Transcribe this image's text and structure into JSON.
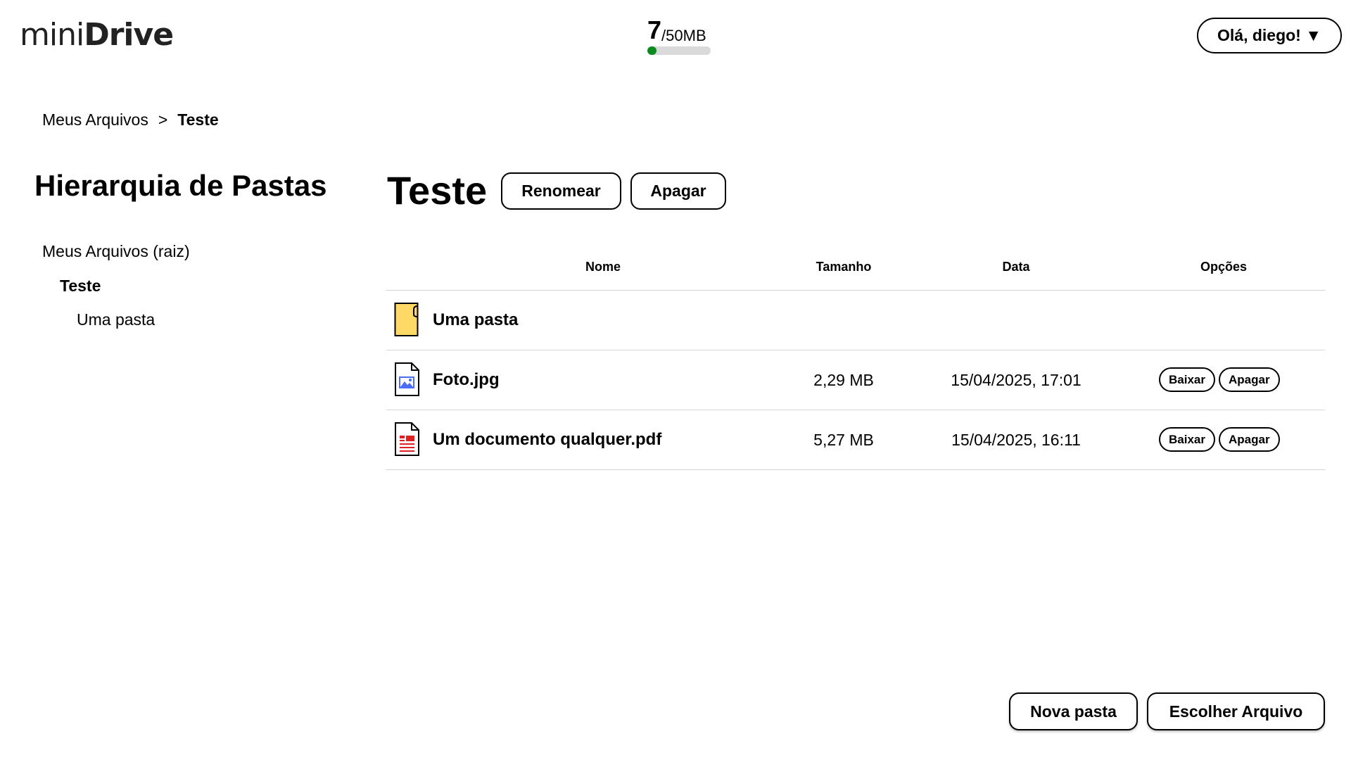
{
  "app": {
    "logo_light": "mini",
    "logo_bold": "Drive"
  },
  "storage": {
    "used": "7",
    "total": "/50MB",
    "used_fraction": 0.14,
    "bar_color": "#0a8a1f"
  },
  "user_menu": {
    "label": "Olá, diego! ▼"
  },
  "breadcrumb": {
    "root": "Meus Arquivos",
    "separator": ">",
    "current": "Teste"
  },
  "sidebar": {
    "title": "Hierarquia de Pastas",
    "tree": [
      {
        "label": "Meus Arquivos (raiz)",
        "level": 0,
        "active": false
      },
      {
        "label": "Teste",
        "level": 1,
        "active": true
      },
      {
        "label": "Uma pasta",
        "level": 2,
        "active": false
      }
    ]
  },
  "main": {
    "folder_title": "Teste",
    "rename_label": "Renomear",
    "delete_label": "Apagar",
    "table": {
      "headers": {
        "name": "Nome",
        "size": "Tamanho",
        "date": "Data",
        "options": "Opções"
      },
      "rows": [
        {
          "type": "folder",
          "icon": "folder-icon",
          "name": "Uma pasta",
          "size": "",
          "date": "",
          "download_label": "",
          "delete_label": ""
        },
        {
          "type": "image",
          "icon": "image-file-icon",
          "name": "Foto.jpg",
          "size": "2,29 MB",
          "date": "15/04/2025, 17:01",
          "download_label": "Baixar",
          "delete_label": "Apagar"
        },
        {
          "type": "pdf",
          "icon": "pdf-file-icon",
          "name": "Um documento qualquer.pdf",
          "size": "5,27 MB",
          "date": "15/04/2025, 16:11",
          "download_label": "Baixar",
          "delete_label": "Apagar"
        }
      ]
    }
  },
  "actions": {
    "new_folder_label": "Nova pasta",
    "choose_file_label": "Escolher Arquivo"
  },
  "colors": {
    "folder_fill": "#ffd966",
    "image_icon_accent": "#4a6cf7",
    "pdf_icon_accent": "#e02020"
  }
}
